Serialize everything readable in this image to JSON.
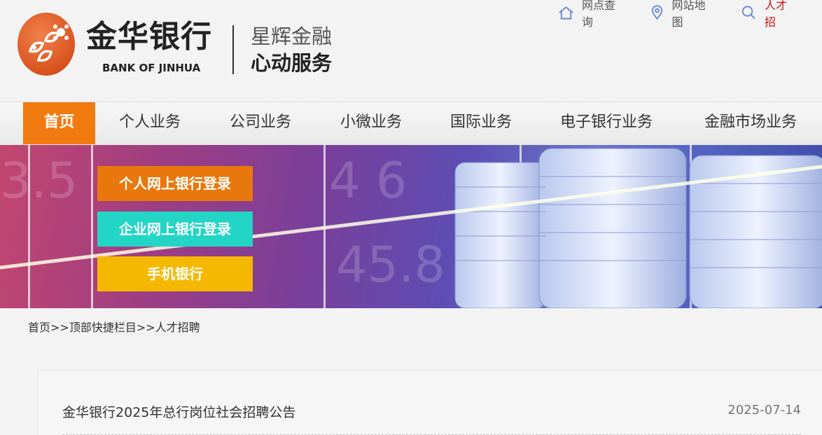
{
  "header": {
    "logo_cn": "金华银行",
    "logo_en": "BANK OF JINHUA",
    "slogan_line1": "星辉金融",
    "slogan_line2": "心动服务",
    "top_links": [
      {
        "label": "网点查询",
        "icon": "home-icon"
      },
      {
        "label": "网站地图",
        "icon": "location-pin-icon"
      },
      {
        "label": "人才招",
        "icon": "search-person-icon"
      }
    ]
  },
  "nav": {
    "items": [
      "首页",
      "个人业务",
      "公司业务",
      "小微业务",
      "国际业务",
      "电子银行业务",
      "金融市场业务"
    ],
    "active_index": 0
  },
  "banner": {
    "buttons": [
      "个人网上银行登录",
      "企业网上银行登录",
      "手机银行"
    ]
  },
  "breadcrumb": {
    "items": [
      "首页",
      "顶部快捷栏目",
      "人才招聘"
    ],
    "separator": ">>"
  },
  "news": [
    {
      "title": "金华银行2025年总行岗位社会招聘公告",
      "date": "2025-07-14"
    }
  ],
  "colors": {
    "accent": "#f07a10",
    "btn_personal": "#e8780d",
    "btn_corp": "#23d5c4",
    "btn_mobile": "#f5b800"
  }
}
